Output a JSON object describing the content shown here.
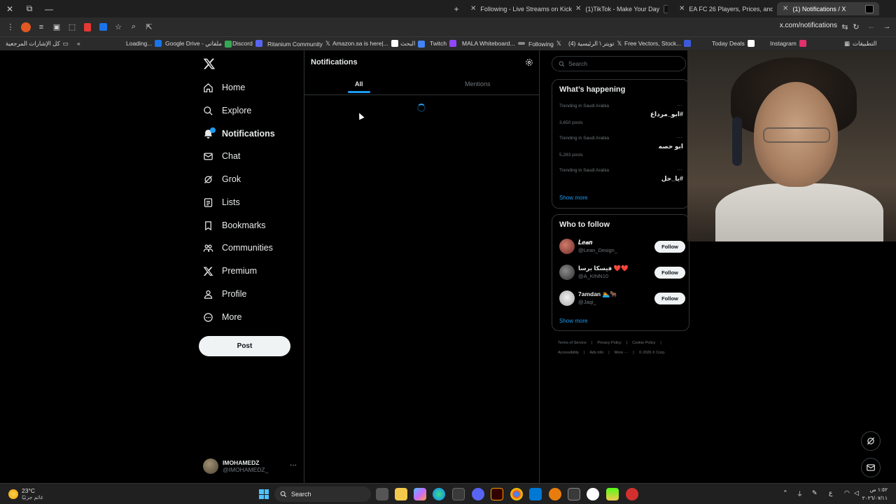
{
  "browser": {
    "tabs": [
      {
        "title": "Following - Live Streams on Kick",
        "fav_color": "#53fc18"
      },
      {
        "title": "(1)TikTok - Make Your Day",
        "fav_color": "#111111"
      },
      {
        "title": "EA FC 26 Players, Prices, and Stats",
        "fav_color": "#c8102e"
      },
      {
        "title": "(1) Notifications / X",
        "fav_color": "#000000"
      }
    ],
    "url": "x.com/notifications",
    "bookmarks": [
      {
        "label": "كل الإشارات المرجعية"
      },
      {
        "label": "Loading..."
      },
      {
        "label": "Google Drive - ملفاتي"
      },
      {
        "label": "Discord"
      },
      {
        "label": "Ritanium Community"
      },
      {
        "label": "Amazon.sa is here|..."
      },
      {
        "label": "البحث"
      },
      {
        "label": "Twitch"
      },
      {
        "label": "MALA Whiteboard..."
      },
      {
        "label": "Following"
      },
      {
        "label": "(4) تويتر \\ الرئيسية"
      },
      {
        "label": "Free Vectors, Stock..."
      },
      {
        "label": "Today Deals"
      },
      {
        "label": "Instagram"
      },
      {
        "label": "التطبيقات"
      }
    ]
  },
  "nav": {
    "items": [
      {
        "label": "Home",
        "icon": "home-icon"
      },
      {
        "label": "Explore",
        "icon": "search-icon"
      },
      {
        "label": "Notifications",
        "icon": "bell-icon"
      },
      {
        "label": "Chat",
        "icon": "mail-icon"
      },
      {
        "label": "Grok",
        "icon": "grok-icon"
      },
      {
        "label": "Lists",
        "icon": "lists-icon"
      },
      {
        "label": "Bookmarks",
        "icon": "bookmark-icon"
      },
      {
        "label": "Communities",
        "icon": "communities-icon"
      },
      {
        "label": "Premium",
        "icon": "x-premium-icon"
      },
      {
        "label": "Profile",
        "icon": "profile-icon"
      },
      {
        "label": "More",
        "icon": "more-circle-icon"
      }
    ],
    "post_label": "Post",
    "account": {
      "name": "IMOHAMEDZ",
      "handle": "@IMOHAMEDZ_"
    }
  },
  "main": {
    "title": "Notifications",
    "tabs": [
      {
        "label": "All"
      },
      {
        "label": "Mentions"
      }
    ]
  },
  "sidebar": {
    "search_placeholder": "Search",
    "happening": {
      "title": "What’s happening",
      "trends": [
        {
          "context": "Trending in Saudi Arabia",
          "name": "#ابو_مرداع",
          "count": "3,650 posts"
        },
        {
          "context": "Trending in Saudi Arabia",
          "name": "ابو حصه",
          "count": "5,283 posts"
        },
        {
          "context": "Trending in Saudi Arabia",
          "name": "#يا_حل",
          "count": ""
        }
      ],
      "show_more": "Show more"
    },
    "who_to_follow": {
      "title": "Who to follow",
      "users": [
        {
          "name": "𝑳𝒆𝒂𝒏",
          "handle": "@Lean_Design_",
          "follow": "Follow"
        },
        {
          "name": "فيسكا برسا ❤️❤️",
          "handle": "@A_KINN10",
          "follow": "Follow"
        },
        {
          "name": "7amdan 🏊🐂",
          "handle": "@Jaqi_",
          "follow": "Follow"
        }
      ],
      "show_more": "Show more"
    },
    "footer": {
      "row1": [
        "Terms of Service",
        "Privacy Policy",
        "Cookie Policy"
      ],
      "row2": [
        "Accessibility",
        "Ads info",
        "More ···",
        "© 2026 X Corp."
      ]
    }
  },
  "taskbar": {
    "weather_temp": "23°C",
    "weather_desc": "غائم جزئيًا",
    "search_label": "Search",
    "lang": "ع",
    "time": "١:٥٢ ص",
    "date": "٢٠٢٦/٠٧/١١"
  }
}
